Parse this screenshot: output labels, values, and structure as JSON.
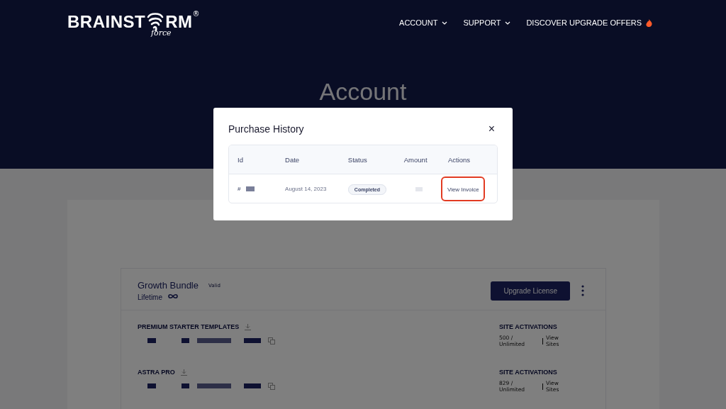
{
  "header": {
    "logo": {
      "before": "BRAINST",
      "after": "RM",
      "mark": "®",
      "sub": "force"
    },
    "nav": [
      {
        "label": "ACCOUNT",
        "kind": "dropdown"
      },
      {
        "label": "SUPPORT",
        "kind": "dropdown"
      },
      {
        "label": "DISCOVER UPGRADE OFFERS",
        "kind": "offer"
      }
    ],
    "title": "Account"
  },
  "license": {
    "name": "Growth Bundle",
    "badge": "Valid",
    "term": "Lifetime",
    "button": "Upgrade License",
    "products": [
      {
        "name": "PREMIUM STARTER TEMPLATES",
        "activations_label": "SITE ACTIVATIONS",
        "count": "500 / Unlimited",
        "link": "View Sites"
      },
      {
        "name": "ASTRA PRO",
        "activations_label": "SITE ACTIVATIONS",
        "count": "829 / Unlimited",
        "link": "View Sites"
      }
    ]
  },
  "modal": {
    "title": "Purchase History",
    "close": "×",
    "columns": [
      "Id",
      "Date",
      "Status",
      "Amount",
      "Actions"
    ],
    "rows": [
      {
        "id_prefix": "#",
        "date": "August 14, 2023",
        "status": "Completed",
        "action": "View Invoice",
        "highlighted": true
      }
    ]
  }
}
